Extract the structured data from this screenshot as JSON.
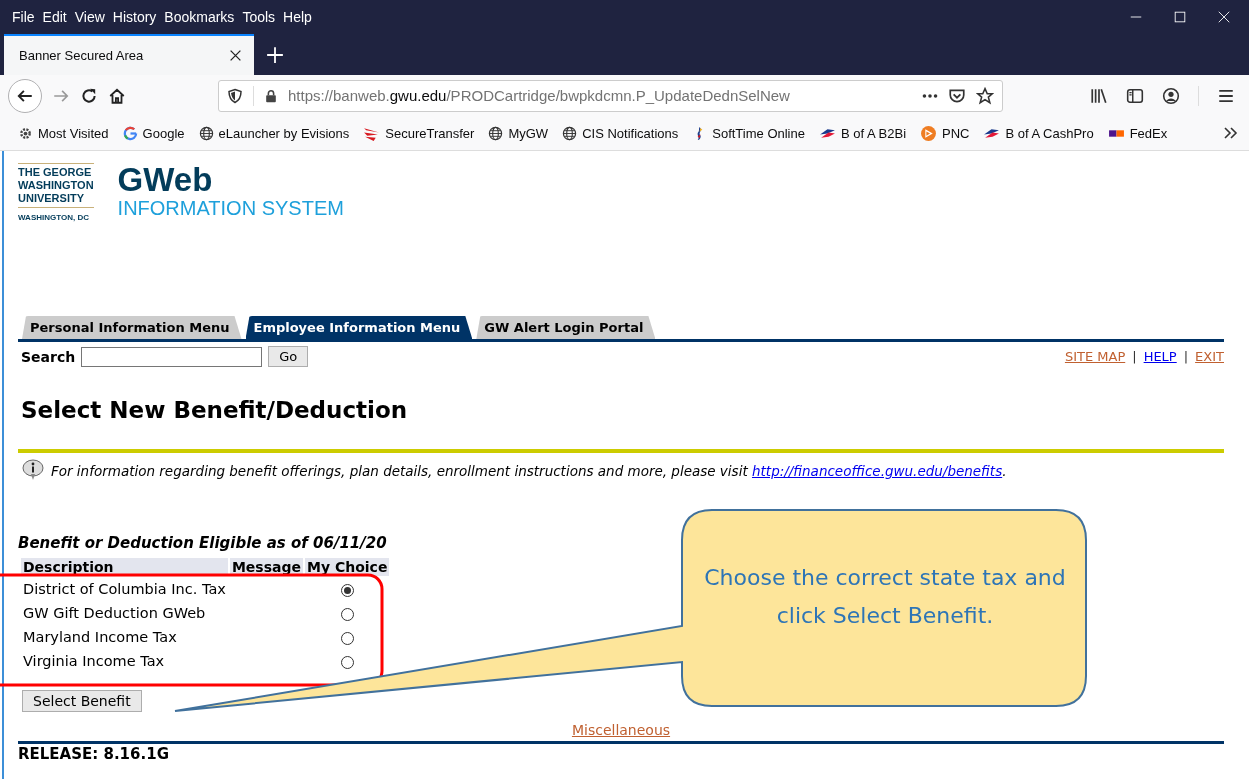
{
  "browser": {
    "menu": [
      "File",
      "Edit",
      "View",
      "History",
      "Bookmarks",
      "Tools",
      "Help"
    ],
    "tab": {
      "title": "Banner Secured Area"
    },
    "url": {
      "scheme": "https://banweb.",
      "domain": "gwu.edu",
      "path": "/PRODCartridge/bwpkdcmn.P_UpdateDednSelNew"
    },
    "bookmarks": [
      "Most Visited",
      "Google",
      "eLauncher by Evisions",
      "SecureTransfer",
      "MyGW",
      "CIS Notifications",
      "SoftTime Online",
      "B of A B2Bi",
      "PNC",
      "B of A CashPro",
      "FedEx"
    ]
  },
  "page": {
    "logo": {
      "lines": [
        "THE GEORGE",
        "WASHINGTON",
        "UNIVERSITY"
      ],
      "place": "WASHINGTON, DC"
    },
    "brand": {
      "title": "GWeb",
      "subtitle": "INFORMATION SYSTEM"
    },
    "tabs": [
      {
        "label": "Personal Information Menu",
        "selected": false
      },
      {
        "label": "Employee Information Menu",
        "selected": true
      },
      {
        "label": "GW Alert Login Portal",
        "selected": false
      }
    ],
    "search": {
      "label": "Search",
      "button": "Go"
    },
    "link_separators": [
      "|",
      "|"
    ],
    "links": [
      {
        "label": "SITE MAP",
        "visited": true
      },
      {
        "label": "HELP",
        "visited": false
      },
      {
        "label": "EXIT",
        "visited": true
      }
    ],
    "heading": "Select New Benefit/Deduction",
    "info": {
      "text": "For information regarding benefit offerings, plan details, enrollment instructions and more, please visit ",
      "link": "http://financeoffice.gwu.edu/benefits",
      "end": "."
    },
    "table": {
      "caption": "Benefit or Deduction Eligible as of 06/11/20",
      "columns": [
        "Description",
        "Message",
        "My Choice"
      ],
      "rows": [
        {
          "description": "District of Columbia Inc. Tax",
          "selected": true
        },
        {
          "description": "GW Gift Deduction GWeb",
          "selected": false
        },
        {
          "description": "Maryland Income Tax",
          "selected": false
        },
        {
          "description": "Virginia Income Tax",
          "selected": false
        }
      ]
    },
    "submit": "Select Benefit",
    "footer_link": {
      "label": "Miscellaneous",
      "visited": true
    },
    "release": "RELEASE: 8.16.1G"
  },
  "callout": {
    "text": "Choose the correct state tax and click Select Benefit."
  }
}
